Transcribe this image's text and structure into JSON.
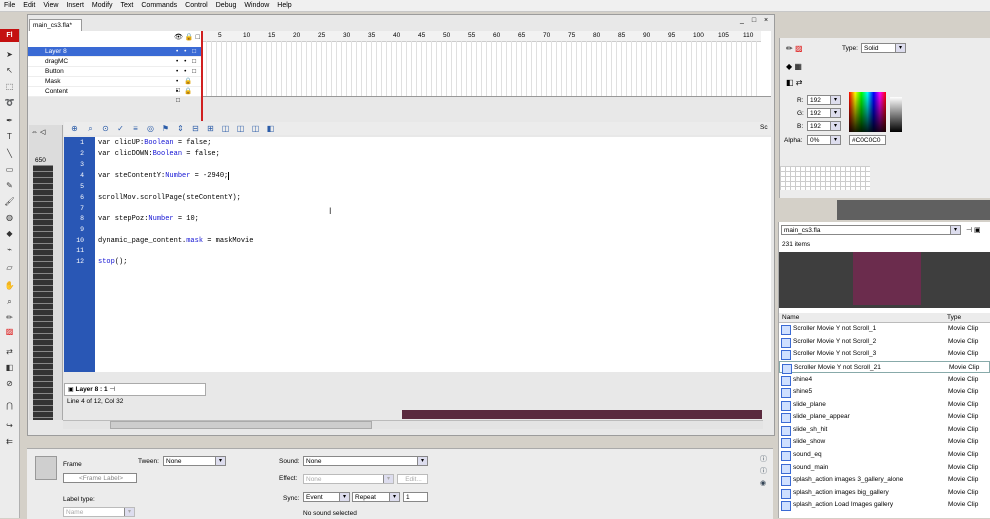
{
  "menu": [
    "File",
    "Edit",
    "View",
    "Insert",
    "Modify",
    "Text",
    "Commands",
    "Control",
    "Debug",
    "Window",
    "Help"
  ],
  "app_logo": "Fl",
  "document": {
    "tab": "main_cs3.fla*",
    "window_controls": "_ □ ×"
  },
  "timeline": {
    "frame_numbers": [
      "5",
      "10",
      "15",
      "20",
      "25",
      "30",
      "35",
      "40",
      "45",
      "50",
      "55",
      "60",
      "65",
      "70",
      "75",
      "80",
      "85",
      "90",
      "95",
      "100",
      "105",
      "110"
    ],
    "layers": [
      {
        "name": "Layer 8",
        "selected": true
      },
      {
        "name": "dragMC",
        "selected": false
      },
      {
        "name": "Button",
        "selected": false
      },
      {
        "name": "Mask",
        "selected": false
      },
      {
        "name": "Content",
        "selected": false
      }
    ]
  },
  "actions": {
    "ruler_label": "650",
    "lines": [
      {
        "n": "1",
        "pre": "var clicUP:",
        "kw": "Boolean",
        "post": " = false;"
      },
      {
        "n": "2",
        "pre": "var clicDOWN:",
        "kw": "Boolean",
        "post": " = false;"
      },
      {
        "n": "3",
        "pre": "",
        "kw": "",
        "post": ""
      },
      {
        "n": "4",
        "pre": "var steContentY:",
        "kw": "Number",
        "post": " = -2940;"
      },
      {
        "n": "5",
        "pre": "",
        "kw": "",
        "post": ""
      },
      {
        "n": "6",
        "pre": "scrollMov.scrollPage(steContentY);",
        "kw": "",
        "post": ""
      },
      {
        "n": "7",
        "pre": "",
        "kw": "",
        "post": ""
      },
      {
        "n": "8",
        "pre": "var stepPoz:",
        "kw": "Number",
        "post": " = 10;"
      },
      {
        "n": "9",
        "pre": "",
        "kw": "",
        "post": ""
      },
      {
        "n": "10",
        "pre": "dynamic_page_content.",
        "kw": "mask",
        "post": " = maskMovie"
      },
      {
        "n": "11",
        "pre": "",
        "kw": "",
        "post": ""
      },
      {
        "n": "12",
        "pre": "",
        "kw": "stop",
        "post": "();"
      }
    ],
    "layer_tab": "Layer 8 : 1",
    "status": "Line 4 of 12, Col 32",
    "sc_label": "Sc"
  },
  "properties": {
    "frame_label": "Frame",
    "frame_label_placeholder": "<Frame Label>",
    "label_type_label": "Label type:",
    "label_type_value": "Name",
    "tween_label": "Tween:",
    "tween_value": "None",
    "sound_label": "Sound:",
    "sound_value": "None",
    "effect_label": "Effect:",
    "effect_value": "None",
    "edit_label": "Edit...",
    "sync_label": "Sync:",
    "sync_value": "Event",
    "repeat_value": "Repeat",
    "repeat_count": "1",
    "no_sound": "No sound selected"
  },
  "color": {
    "type_label": "Type:",
    "type_value": "Solid",
    "r_label": "R:",
    "r_value": "192",
    "g_label": "G:",
    "g_value": "192",
    "b_label": "B:",
    "b_value": "192",
    "alpha_label": "Alpha:",
    "alpha_value": "0%",
    "hex": "#C0C0C0"
  },
  "library": {
    "file": "main_cs3.fla",
    "count": "231 items",
    "col_name": "Name",
    "col_type": "Type",
    "items": [
      {
        "name": "Scroller Movie Y not Scroll_1",
        "type": "Movie Clip"
      },
      {
        "name": "Scroller Movie Y not Scroll_2",
        "type": "Movie Clip"
      },
      {
        "name": "Scroller Movie Y not Scroll_3",
        "type": "Movie Clip"
      },
      {
        "name": "Scroller Movie Y not Scroll_21",
        "type": "Movie Clip"
      },
      {
        "name": "shine4",
        "type": "Movie Clip"
      },
      {
        "name": "shine5",
        "type": "Movie Clip"
      },
      {
        "name": "slide_plane",
        "type": "Movie Clip"
      },
      {
        "name": "slide_plane_appear",
        "type": "Movie Clip"
      },
      {
        "name": "slide_sh_hit",
        "type": "Movie Clip"
      },
      {
        "name": "slide_show",
        "type": "Movie Clip"
      },
      {
        "name": "sound_eq",
        "type": "Movie Clip"
      },
      {
        "name": "sound_main",
        "type": "Movie Clip"
      },
      {
        "name": "splash_action images 3_gallery_alone",
        "type": "Movie Clip"
      },
      {
        "name": "splash_action images big_gallery",
        "type": "Movie Clip"
      },
      {
        "name": "splash_action Load Images gallery",
        "type": "Movie Clip"
      }
    ]
  }
}
